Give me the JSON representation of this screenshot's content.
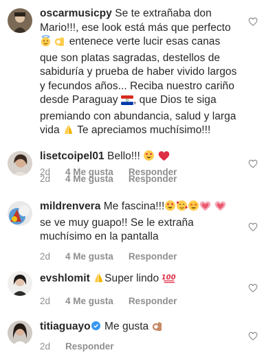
{
  "comments": [
    {
      "username": "oscarmusicpy",
      "verified": false,
      "text_lines": [
        " Se te extrañaba don",
        "Mario!!!, ese look está más  que perfecto",
        "  entenece verte lucir esas canas",
        "que son platas sagradas, destellos de",
        "sabiduría y prueba de haber vivido largos",
        "y fecundos años... Reciba nuestro cariño",
        "desde Paraguay ",
        ", que Dios  te siga",
        "premiando con abundancia, salud y larga",
        "vida ",
        "  Te apreciamos muchísimo!!!"
      ],
      "time": "2d",
      "likes": "4 Me gusta",
      "reply": "Responder",
      "emojis": [
        "face-with-halo-emoji",
        "ok-hand-emoji",
        "paraguay-flag-emoji",
        "folded-hands-emoji"
      ]
    },
    {
      "username": "lisetcoipel01",
      "verified": false,
      "text": " Bello!!! ",
      "time": "2d",
      "likes": "4 Me gusta",
      "reply": "Responder",
      "emojis": [
        "heart-eyes-emoji",
        "red-heart-emoji"
      ]
    },
    {
      "username": "mildrenvera",
      "verified": false,
      "text_lines": [
        " Me fascina!!!",
        "se ve muy guapo!! Se le extraña",
        "muchísimo en la pantalla"
      ],
      "time": "2d",
      "likes": "4 Me gusta",
      "reply": "Responder",
      "emojis": [
        "heart-eyes-emoji",
        "smiling-face-with-hearts-emoji",
        "star-struck-emoji",
        "growing-heart-emoji",
        "growing-heart-emoji"
      ]
    },
    {
      "username": "evshlomit",
      "verified": false,
      "text": "Super lindo ",
      "time": "2d",
      "likes": "4 Me gusta",
      "reply": "Responder",
      "emojis": [
        "folded-hands-emoji",
        "hundred-points-emoji"
      ]
    },
    {
      "username": "titiaguayo",
      "verified": true,
      "text": " Me gusta ",
      "time": "2d",
      "likes": "",
      "reply": "Responder",
      "emojis": [
        "ok-hand-emoji"
      ]
    }
  ],
  "colors": {
    "text": "#262626",
    "meta": "#8e8e8e",
    "verified": "#3897f0"
  }
}
